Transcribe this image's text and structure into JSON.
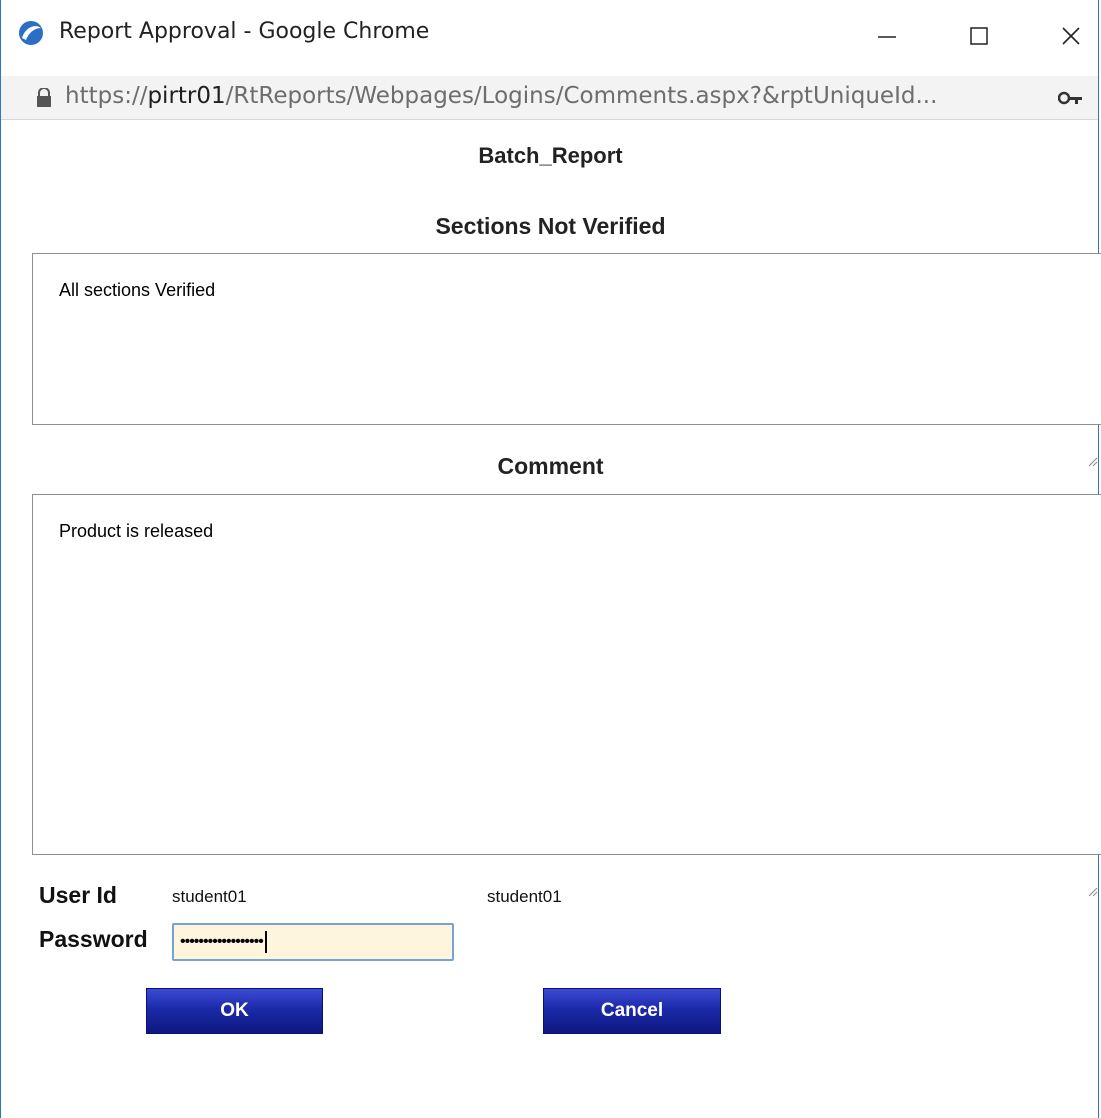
{
  "window": {
    "title": "Report Approval - Google Chrome",
    "url_scheme": "https://",
    "url_host": "pirtr01",
    "url_path": "/RtReports/Webpages/Logins/Comments.aspx?&rptUniqueId...",
    "accent": "#2b78c6"
  },
  "page": {
    "report_name": "Batch_Report",
    "sections_heading": "Sections Not Verified",
    "sections_value": "All sections Verified",
    "comment_heading": "Comment",
    "comment_value": "Product is released"
  },
  "form": {
    "user_id_label": "User Id",
    "user_id_value_1": "student01",
    "user_id_value_2": "student01",
    "password_label": "Password",
    "password_mask": "••••••••••••••••••",
    "ok_label": "OK",
    "cancel_label": "Cancel",
    "button_color": "#1b2aa8",
    "password_bg": "#fdf6dc"
  },
  "icons": {
    "app": "chrome-app-icon",
    "minimize": "minimize-icon",
    "maximize": "maximize-icon",
    "close": "close-icon",
    "lock": "lock-icon",
    "key": "key-icon"
  }
}
